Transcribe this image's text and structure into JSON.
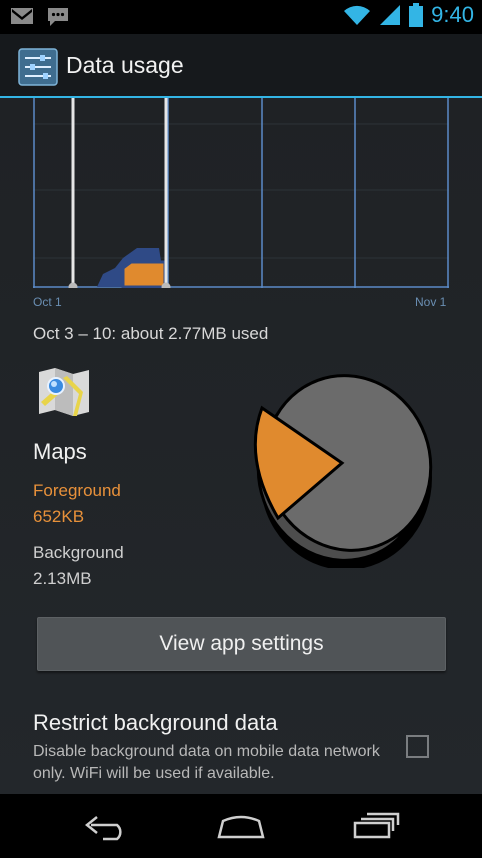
{
  "status_bar": {
    "time": "9:40",
    "icons": [
      "gmail-icon",
      "sms-icon",
      "wifi-icon",
      "signal-icon",
      "battery-icon"
    ]
  },
  "action_bar": {
    "title": "Data usage",
    "icon": "settings-sliders-icon"
  },
  "chart": {
    "x_start_label": "Oct 1",
    "x_end_label": "Nov 1",
    "colors": {
      "grid": "#5b8ac7",
      "usage": "#2f4a86",
      "selected_usage": "#e08a2e",
      "marker": "#e6e6e6"
    }
  },
  "summary": {
    "range_text": "Oct 3 – 10: about 2.77MB used"
  },
  "app_detail": {
    "icon": "maps-icon",
    "name": "Maps",
    "foreground_label": "Foreground",
    "foreground_value": "652KB",
    "background_label": "Background",
    "background_value": "2.13MB",
    "pie": {
      "foreground_fraction": 0.23,
      "foreground_color": "#e08a2e",
      "background_color": "#6b6b6b"
    }
  },
  "view_settings_button": "View app settings",
  "restrict": {
    "title": "Restrict background data",
    "description": "Disable background data on mobile data network only. WiFi will be used if available.",
    "checked": false
  },
  "nav_bar": {
    "items": [
      "back-icon",
      "home-icon",
      "recents-icon"
    ]
  }
}
